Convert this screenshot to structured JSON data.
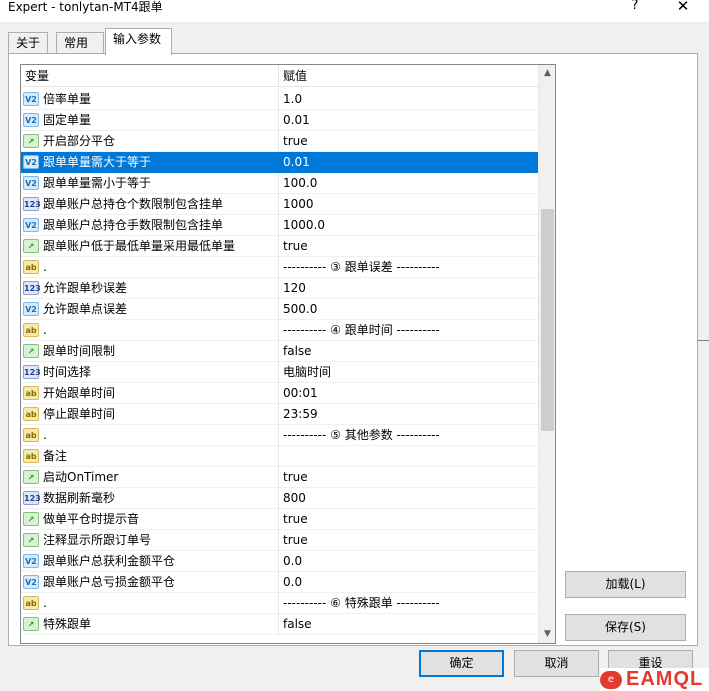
{
  "window": {
    "title": "Expert - tonlytan-MT4跟单",
    "help_glyph": "?",
    "close_glyph": "✕"
  },
  "tabs": [
    {
      "label": "关于",
      "active": false
    },
    {
      "label": "常用",
      "active": false
    },
    {
      "label": "输入参数",
      "active": true
    }
  ],
  "grid": {
    "columns": [
      "变量",
      "赋值"
    ],
    "rows": [
      {
        "icon": "v2",
        "icon_text": "V2",
        "name": "倍率单量",
        "value": "1.0"
      },
      {
        "icon": "v2",
        "icon_text": "V2",
        "name": "固定单量",
        "value": "0.01"
      },
      {
        "icon": "bool",
        "icon_text": "↗",
        "name": "开启部分平仓",
        "value": "true"
      },
      {
        "icon": "v2",
        "icon_text": "V2",
        "name": "跟单单量需大于等于",
        "value": "0.01",
        "selected": true
      },
      {
        "icon": "v2",
        "icon_text": "V2",
        "name": "跟单单量需小于等于",
        "value": "100.0"
      },
      {
        "icon": "num",
        "icon_text": "123",
        "name": "跟单账户总持仓个数限制包含挂单",
        "value": "1000"
      },
      {
        "icon": "v2",
        "icon_text": "V2",
        "name": "跟单账户总持仓手数限制包含挂单",
        "value": "1000.0"
      },
      {
        "icon": "bool",
        "icon_text": "↗",
        "name": "跟单账户低于最低单量采用最低单量",
        "value": "true"
      },
      {
        "icon": "ab",
        "icon_text": "ab",
        "name": ".",
        "value": "---------- ③ 跟单误差 ----------"
      },
      {
        "icon": "num",
        "icon_text": "123",
        "name": "允许跟单秒误差",
        "value": "120"
      },
      {
        "icon": "v2",
        "icon_text": "V2",
        "name": "允许跟单点误差",
        "value": "500.0"
      },
      {
        "icon": "ab",
        "icon_text": "ab",
        "name": ".",
        "value": "---------- ④ 跟单时间 ----------"
      },
      {
        "icon": "bool",
        "icon_text": "↗",
        "name": "跟单时间限制",
        "value": "false"
      },
      {
        "icon": "num",
        "icon_text": "123",
        "name": "时间选择",
        "value": "电脑时间"
      },
      {
        "icon": "ab",
        "icon_text": "ab",
        "name": "开始跟单时间",
        "value": "00:01"
      },
      {
        "icon": "ab",
        "icon_text": "ab",
        "name": "停止跟单时间",
        "value": "23:59"
      },
      {
        "icon": "ab",
        "icon_text": "ab",
        "name": ".",
        "value": "---------- ⑤ 其他参数 ----------"
      },
      {
        "icon": "ab",
        "icon_text": "ab",
        "name": "备注",
        "value": ""
      },
      {
        "icon": "bool",
        "icon_text": "↗",
        "name": "启动OnTimer",
        "value": "true"
      },
      {
        "icon": "num",
        "icon_text": "123",
        "name": "数据刷新毫秒",
        "value": "800"
      },
      {
        "icon": "bool",
        "icon_text": "↗",
        "name": "做单平仓时提示音",
        "value": "true"
      },
      {
        "icon": "bool",
        "icon_text": "↗",
        "name": "注释显示所跟订单号",
        "value": "true"
      },
      {
        "icon": "v2",
        "icon_text": "V2",
        "name": "跟单账户总获利金额平仓",
        "value": "0.0"
      },
      {
        "icon": "v2",
        "icon_text": "V2",
        "name": "跟单账户总亏损金额平仓",
        "value": "0.0"
      },
      {
        "icon": "ab",
        "icon_text": "ab",
        "name": ".",
        "value": "---------- ⑥ 特殊跟单 ----------"
      },
      {
        "icon": "bool",
        "icon_text": "↗",
        "name": "特殊跟单",
        "value": "false"
      }
    ],
    "scroll_up_glyph": "▲",
    "scroll_down_glyph": "▼"
  },
  "buttons": {
    "load": "加载(L)",
    "save": "保存(S)",
    "ok": "确定",
    "cancel": "取消",
    "reset": "重设"
  },
  "watermark": {
    "badge": "e",
    "text": "EAMQL"
  }
}
